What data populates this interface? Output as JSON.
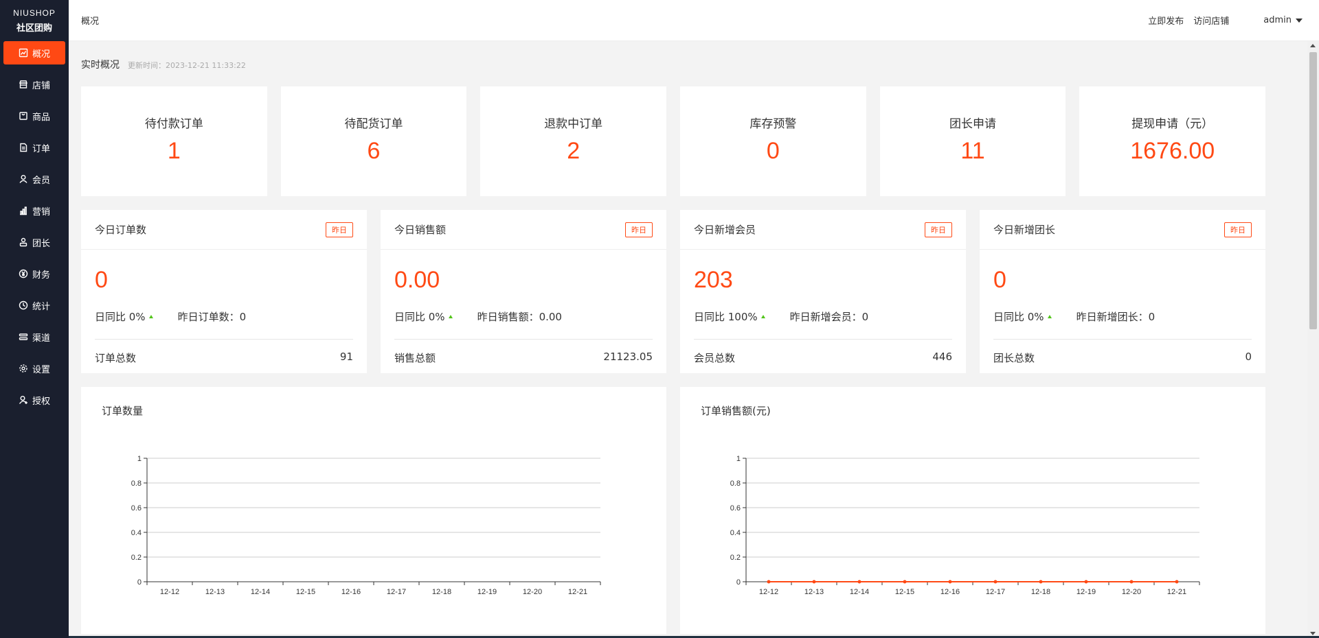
{
  "logo": {
    "top": "NIUSHOP",
    "bottom": "社区团购"
  },
  "sidebar": {
    "items": [
      {
        "label": "概况",
        "icon": "chart-icon",
        "active": true
      },
      {
        "label": "店铺",
        "icon": "store-icon"
      },
      {
        "label": "商品",
        "icon": "goods-icon"
      },
      {
        "label": "订单",
        "icon": "order-icon"
      },
      {
        "label": "会员",
        "icon": "member-icon"
      },
      {
        "label": "营销",
        "icon": "marketing-icon"
      },
      {
        "label": "团长",
        "icon": "leader-icon"
      },
      {
        "label": "财务",
        "icon": "finance-icon"
      },
      {
        "label": "统计",
        "icon": "stats-icon"
      },
      {
        "label": "渠道",
        "icon": "channel-icon"
      },
      {
        "label": "设置",
        "icon": "settings-icon"
      },
      {
        "label": "授权",
        "icon": "auth-icon"
      }
    ]
  },
  "header": {
    "breadcrumb": "概况",
    "publish": "立即发布",
    "visit_store": "访问店铺",
    "user": "admin"
  },
  "overview": {
    "title": "实时概况",
    "update_time": "更新时间：2023-12-21 11:33:22"
  },
  "stats": [
    {
      "label": "待付款订单",
      "value": "1"
    },
    {
      "label": "待配货订单",
      "value": "6"
    },
    {
      "label": "退款中订单",
      "value": "2"
    },
    {
      "label": "库存预警",
      "value": "0"
    },
    {
      "label": "团长申请",
      "value": "11"
    },
    {
      "label": "提现申请（元）",
      "value": "1676.00"
    }
  ],
  "today_cards": [
    {
      "title": "今日订单数",
      "button": "昨日",
      "value": "0",
      "compare": "日同比 0%",
      "yesterday": "昨日订单数：0",
      "total_label": "订单总数",
      "total_value": "91"
    },
    {
      "title": "今日销售额",
      "button": "昨日",
      "value": "0.00",
      "compare": "日同比 0%",
      "yesterday": "昨日销售额：0.00",
      "total_label": "销售总额",
      "total_value": "21123.05"
    },
    {
      "title": "今日新增会员",
      "button": "昨日",
      "value": "203",
      "compare": "日同比 100%",
      "yesterday": "昨日新增会员：0",
      "total_label": "会员总数",
      "total_value": "446"
    },
    {
      "title": "今日新增团长",
      "button": "昨日",
      "value": "0",
      "compare": "日同比 0%",
      "yesterday": "昨日新增团长：0",
      "total_label": "团长总数",
      "total_value": "0"
    }
  ],
  "colors": {
    "accent": "#ff4914",
    "sidebar": "#1a1f2e",
    "up": "#52c41a"
  },
  "chart_data": [
    {
      "type": "line",
      "title": "订单数量",
      "categories": [
        "12-12",
        "12-13",
        "12-14",
        "12-15",
        "12-16",
        "12-17",
        "12-18",
        "12-19",
        "12-20",
        "12-21"
      ],
      "yticks": [
        "0",
        "0.2",
        "0.4",
        "0.6",
        "0.8",
        "1"
      ],
      "ylim": [
        0,
        1
      ],
      "series": [
        {
          "values": []
        }
      ],
      "grid": true
    },
    {
      "type": "line",
      "title": "订单销售额(元)",
      "categories": [
        "12-12",
        "12-13",
        "12-14",
        "12-15",
        "12-16",
        "12-17",
        "12-18",
        "12-19",
        "12-20",
        "12-21"
      ],
      "yticks": [
        "0",
        "0.2",
        "0.4",
        "0.6",
        "0.8",
        "1"
      ],
      "ylim": [
        0,
        1
      ],
      "series": [
        {
          "values": [
            0,
            0,
            0,
            0,
            0,
            0,
            0,
            0,
            0,
            0
          ],
          "color": "#ff4914"
        }
      ],
      "grid": true
    }
  ]
}
